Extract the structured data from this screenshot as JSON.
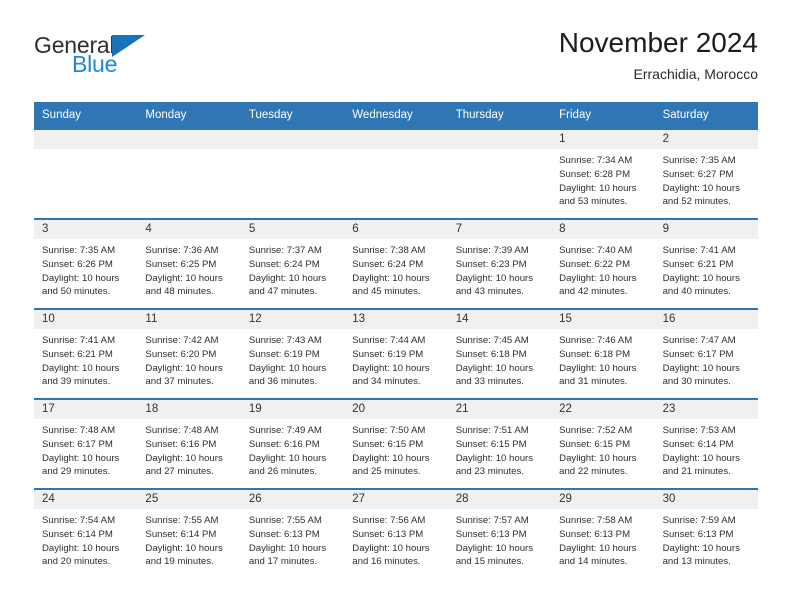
{
  "brand": {
    "line1": "General",
    "line2": "Blue",
    "triangle_icon": "brand-triangle-icon",
    "colors": {
      "text": "#2f2f2f",
      "blue": "#1f87d8",
      "triangle": "#1a72b8"
    }
  },
  "header": {
    "title": "November 2024",
    "subtitle": "Errachidia, Morocco"
  },
  "theme": {
    "header_blue": "#3076b4",
    "day_band_gray": "#f0f0f0",
    "row_rule": "#3076b4"
  },
  "weekdays": [
    "Sunday",
    "Monday",
    "Tuesday",
    "Wednesday",
    "Thursday",
    "Friday",
    "Saturday"
  ],
  "weeks": [
    [
      {
        "day": "",
        "sunrise": "",
        "sunset": "",
        "daylight1": "",
        "daylight2": "",
        "empty": true
      },
      {
        "day": "",
        "sunrise": "",
        "sunset": "",
        "daylight1": "",
        "daylight2": "",
        "empty": true
      },
      {
        "day": "",
        "sunrise": "",
        "sunset": "",
        "daylight1": "",
        "daylight2": "",
        "empty": true
      },
      {
        "day": "",
        "sunrise": "",
        "sunset": "",
        "daylight1": "",
        "daylight2": "",
        "empty": true
      },
      {
        "day": "",
        "sunrise": "",
        "sunset": "",
        "daylight1": "",
        "daylight2": "",
        "empty": true
      },
      {
        "day": "1",
        "sunrise": "Sunrise: 7:34 AM",
        "sunset": "Sunset: 6:28 PM",
        "daylight1": "Daylight: 10 hours",
        "daylight2": "and 53 minutes.",
        "empty": false
      },
      {
        "day": "2",
        "sunrise": "Sunrise: 7:35 AM",
        "sunset": "Sunset: 6:27 PM",
        "daylight1": "Daylight: 10 hours",
        "daylight2": "and 52 minutes.",
        "empty": false
      }
    ],
    [
      {
        "day": "3",
        "sunrise": "Sunrise: 7:35 AM",
        "sunset": "Sunset: 6:26 PM",
        "daylight1": "Daylight: 10 hours",
        "daylight2": "and 50 minutes.",
        "empty": false
      },
      {
        "day": "4",
        "sunrise": "Sunrise: 7:36 AM",
        "sunset": "Sunset: 6:25 PM",
        "daylight1": "Daylight: 10 hours",
        "daylight2": "and 48 minutes.",
        "empty": false
      },
      {
        "day": "5",
        "sunrise": "Sunrise: 7:37 AM",
        "sunset": "Sunset: 6:24 PM",
        "daylight1": "Daylight: 10 hours",
        "daylight2": "and 47 minutes.",
        "empty": false
      },
      {
        "day": "6",
        "sunrise": "Sunrise: 7:38 AM",
        "sunset": "Sunset: 6:24 PM",
        "daylight1": "Daylight: 10 hours",
        "daylight2": "and 45 minutes.",
        "empty": false
      },
      {
        "day": "7",
        "sunrise": "Sunrise: 7:39 AM",
        "sunset": "Sunset: 6:23 PM",
        "daylight1": "Daylight: 10 hours",
        "daylight2": "and 43 minutes.",
        "empty": false
      },
      {
        "day": "8",
        "sunrise": "Sunrise: 7:40 AM",
        "sunset": "Sunset: 6:22 PM",
        "daylight1": "Daylight: 10 hours",
        "daylight2": "and 42 minutes.",
        "empty": false
      },
      {
        "day": "9",
        "sunrise": "Sunrise: 7:41 AM",
        "sunset": "Sunset: 6:21 PM",
        "daylight1": "Daylight: 10 hours",
        "daylight2": "and 40 minutes.",
        "empty": false
      }
    ],
    [
      {
        "day": "10",
        "sunrise": "Sunrise: 7:41 AM",
        "sunset": "Sunset: 6:21 PM",
        "daylight1": "Daylight: 10 hours",
        "daylight2": "and 39 minutes.",
        "empty": false
      },
      {
        "day": "11",
        "sunrise": "Sunrise: 7:42 AM",
        "sunset": "Sunset: 6:20 PM",
        "daylight1": "Daylight: 10 hours",
        "daylight2": "and 37 minutes.",
        "empty": false
      },
      {
        "day": "12",
        "sunrise": "Sunrise: 7:43 AM",
        "sunset": "Sunset: 6:19 PM",
        "daylight1": "Daylight: 10 hours",
        "daylight2": "and 36 minutes.",
        "empty": false
      },
      {
        "day": "13",
        "sunrise": "Sunrise: 7:44 AM",
        "sunset": "Sunset: 6:19 PM",
        "daylight1": "Daylight: 10 hours",
        "daylight2": "and 34 minutes.",
        "empty": false
      },
      {
        "day": "14",
        "sunrise": "Sunrise: 7:45 AM",
        "sunset": "Sunset: 6:18 PM",
        "daylight1": "Daylight: 10 hours",
        "daylight2": "and 33 minutes.",
        "empty": false
      },
      {
        "day": "15",
        "sunrise": "Sunrise: 7:46 AM",
        "sunset": "Sunset: 6:18 PM",
        "daylight1": "Daylight: 10 hours",
        "daylight2": "and 31 minutes.",
        "empty": false
      },
      {
        "day": "16",
        "sunrise": "Sunrise: 7:47 AM",
        "sunset": "Sunset: 6:17 PM",
        "daylight1": "Daylight: 10 hours",
        "daylight2": "and 30 minutes.",
        "empty": false
      }
    ],
    [
      {
        "day": "17",
        "sunrise": "Sunrise: 7:48 AM",
        "sunset": "Sunset: 6:17 PM",
        "daylight1": "Daylight: 10 hours",
        "daylight2": "and 29 minutes.",
        "empty": false
      },
      {
        "day": "18",
        "sunrise": "Sunrise: 7:48 AM",
        "sunset": "Sunset: 6:16 PM",
        "daylight1": "Daylight: 10 hours",
        "daylight2": "and 27 minutes.",
        "empty": false
      },
      {
        "day": "19",
        "sunrise": "Sunrise: 7:49 AM",
        "sunset": "Sunset: 6:16 PM",
        "daylight1": "Daylight: 10 hours",
        "daylight2": "and 26 minutes.",
        "empty": false
      },
      {
        "day": "20",
        "sunrise": "Sunrise: 7:50 AM",
        "sunset": "Sunset: 6:15 PM",
        "daylight1": "Daylight: 10 hours",
        "daylight2": "and 25 minutes.",
        "empty": false
      },
      {
        "day": "21",
        "sunrise": "Sunrise: 7:51 AM",
        "sunset": "Sunset: 6:15 PM",
        "daylight1": "Daylight: 10 hours",
        "daylight2": "and 23 minutes.",
        "empty": false
      },
      {
        "day": "22",
        "sunrise": "Sunrise: 7:52 AM",
        "sunset": "Sunset: 6:15 PM",
        "daylight1": "Daylight: 10 hours",
        "daylight2": "and 22 minutes.",
        "empty": false
      },
      {
        "day": "23",
        "sunrise": "Sunrise: 7:53 AM",
        "sunset": "Sunset: 6:14 PM",
        "daylight1": "Daylight: 10 hours",
        "daylight2": "and 21 minutes.",
        "empty": false
      }
    ],
    [
      {
        "day": "24",
        "sunrise": "Sunrise: 7:54 AM",
        "sunset": "Sunset: 6:14 PM",
        "daylight1": "Daylight: 10 hours",
        "daylight2": "and 20 minutes.",
        "empty": false
      },
      {
        "day": "25",
        "sunrise": "Sunrise: 7:55 AM",
        "sunset": "Sunset: 6:14 PM",
        "daylight1": "Daylight: 10 hours",
        "daylight2": "and 19 minutes.",
        "empty": false
      },
      {
        "day": "26",
        "sunrise": "Sunrise: 7:55 AM",
        "sunset": "Sunset: 6:13 PM",
        "daylight1": "Daylight: 10 hours",
        "daylight2": "and 17 minutes.",
        "empty": false
      },
      {
        "day": "27",
        "sunrise": "Sunrise: 7:56 AM",
        "sunset": "Sunset: 6:13 PM",
        "daylight1": "Daylight: 10 hours",
        "daylight2": "and 16 minutes.",
        "empty": false
      },
      {
        "day": "28",
        "sunrise": "Sunrise: 7:57 AM",
        "sunset": "Sunset: 6:13 PM",
        "daylight1": "Daylight: 10 hours",
        "daylight2": "and 15 minutes.",
        "empty": false
      },
      {
        "day": "29",
        "sunrise": "Sunrise: 7:58 AM",
        "sunset": "Sunset: 6:13 PM",
        "daylight1": "Daylight: 10 hours",
        "daylight2": "and 14 minutes.",
        "empty": false
      },
      {
        "day": "30",
        "sunrise": "Sunrise: 7:59 AM",
        "sunset": "Sunset: 6:13 PM",
        "daylight1": "Daylight: 10 hours",
        "daylight2": "and 13 minutes.",
        "empty": false
      }
    ]
  ]
}
